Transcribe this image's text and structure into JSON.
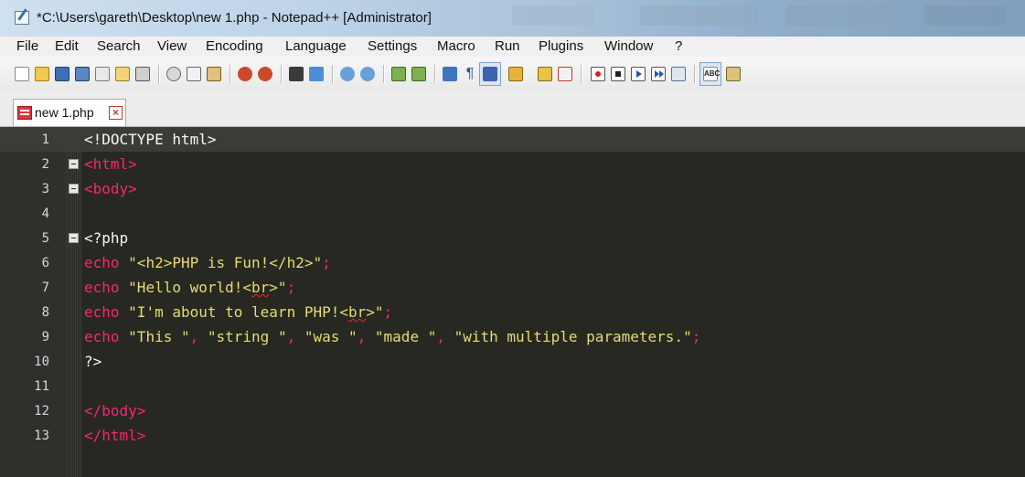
{
  "window": {
    "title": "*C:\\Users\\gareth\\Desktop\\new  1.php - Notepad++ [Administrator]"
  },
  "menu": {
    "items": [
      "File",
      "Edit",
      "Search",
      "View",
      "Encoding",
      "Language",
      "Settings",
      "Macro",
      "Run",
      "Plugins",
      "Window",
      "?"
    ]
  },
  "toolbar": {
    "icons": [
      "new-file-icon",
      "open-file-icon",
      "save-icon",
      "save-all-icon",
      "close-icon",
      "close-all-icon",
      "print-icon",
      "cut-icon",
      "copy-icon",
      "paste-icon",
      "undo-icon",
      "redo-icon",
      "find-icon",
      "replace-icon",
      "zoom-in-icon",
      "zoom-out-icon",
      "sync-vertical-icon",
      "sync-horizontal-icon",
      "word-wrap-icon",
      "show-all-characters-icon",
      "indent-guide-icon",
      "user-defined-language-icon",
      "doc-map-icon",
      "function-list-icon",
      "record-macro-icon",
      "stop-record-icon",
      "play-macro-icon",
      "run-macro-multiple-icon",
      "save-macro-icon",
      "spell-check-icon",
      "spell-check-options-icon"
    ]
  },
  "tabs": [
    {
      "label": "new  1.php",
      "active": true
    }
  ],
  "editor": {
    "current_line": 1,
    "lines": [
      {
        "num": "1",
        "fold": false,
        "tokens": [
          {
            "t": "<!DOCTYPE html>",
            "c": "plain"
          }
        ]
      },
      {
        "num": "2",
        "fold": true,
        "tokens": [
          {
            "t": "<html>",
            "c": "tag"
          }
        ]
      },
      {
        "num": "3",
        "fold": true,
        "tokens": [
          {
            "t": "<body>",
            "c": "tag"
          }
        ]
      },
      {
        "num": "4",
        "fold": false,
        "tokens": []
      },
      {
        "num": "5",
        "fold": true,
        "tokens": [
          {
            "t": "<?php",
            "c": "plain"
          }
        ]
      },
      {
        "num": "6",
        "fold": false,
        "tokens": [
          {
            "t": "echo ",
            "c": "kw"
          },
          {
            "t": "\"<h2>PHP is Fun!</h2>\"",
            "c": "str"
          },
          {
            "t": ";",
            "c": "punc"
          }
        ]
      },
      {
        "num": "7",
        "fold": false,
        "tokens": [
          {
            "t": "echo ",
            "c": "kw"
          },
          {
            "t": "\"Hello world!<",
            "c": "str"
          },
          {
            "t": "br",
            "c": "str",
            "sq": true
          },
          {
            "t": ">\"",
            "c": "str"
          },
          {
            "t": ";",
            "c": "punc"
          }
        ]
      },
      {
        "num": "8",
        "fold": false,
        "tokens": [
          {
            "t": "echo ",
            "c": "kw"
          },
          {
            "t": "\"I'm about to learn PHP!<",
            "c": "str"
          },
          {
            "t": "br",
            "c": "str",
            "sq": true
          },
          {
            "t": ">\"",
            "c": "str"
          },
          {
            "t": ";",
            "c": "punc"
          }
        ]
      },
      {
        "num": "9",
        "fold": false,
        "tokens": [
          {
            "t": "echo ",
            "c": "kw"
          },
          {
            "t": "\"This \"",
            "c": "str"
          },
          {
            "t": ", ",
            "c": "punc"
          },
          {
            "t": "\"string \"",
            "c": "str"
          },
          {
            "t": ", ",
            "c": "punc"
          },
          {
            "t": "\"was \"",
            "c": "str"
          },
          {
            "t": ", ",
            "c": "punc"
          },
          {
            "t": "\"made \"",
            "c": "str"
          },
          {
            "t": ", ",
            "c": "punc"
          },
          {
            "t": "\"with multiple parameters.\"",
            "c": "str"
          },
          {
            "t": ";",
            "c": "punc"
          }
        ]
      },
      {
        "num": "10",
        "fold": false,
        "tokens": [
          {
            "t": "?>",
            "c": "plain"
          }
        ]
      },
      {
        "num": "11",
        "fold": false,
        "tokens": []
      },
      {
        "num": "12",
        "fold": false,
        "tokens": [
          {
            "t": "</body>",
            "c": "tag"
          }
        ]
      },
      {
        "num": "13",
        "fold": false,
        "tokens": [
          {
            "t": "</html>",
            "c": "tag"
          }
        ]
      }
    ]
  },
  "colors": {
    "editor_bg": "#272822",
    "tag": "#f92672",
    "string": "#e6db74",
    "text": "#f8f8f2",
    "current_line": "#3b3c36"
  }
}
